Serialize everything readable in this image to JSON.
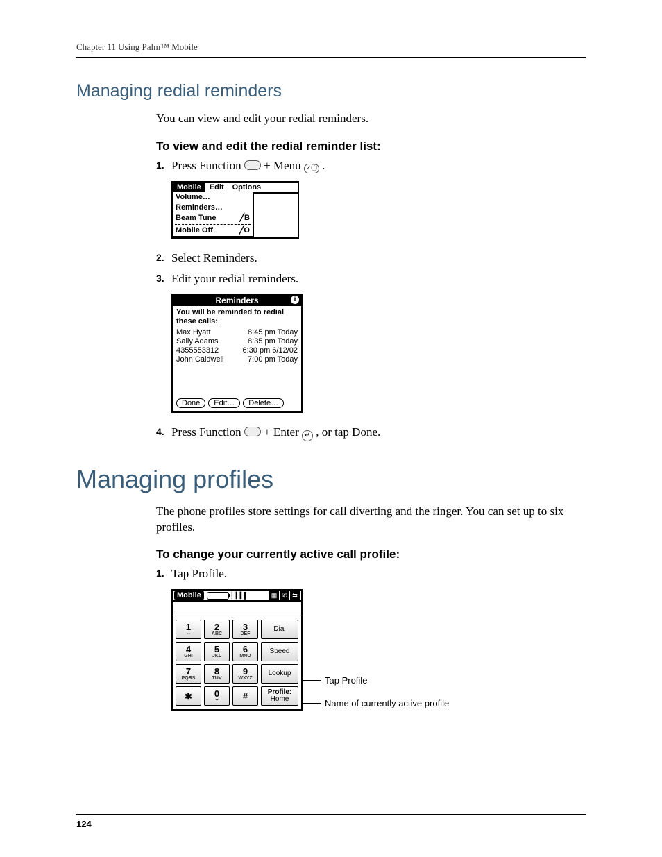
{
  "runningHead": "Chapter 11   Using Palm™ Mobile",
  "section1": {
    "title": "Managing redial reminders",
    "intro": "You can view and edit your redial reminders.",
    "procTitle": "To view and edit the redial reminder list:",
    "steps": {
      "s1a": "Press Function ",
      "s1b": " + Menu ",
      "s1c": ".",
      "s2": "Select Reminders.",
      "s3": "Edit your redial reminders.",
      "s4a": "Press Function ",
      "s4b": " + Enter ",
      "s4c": ", or tap Done."
    }
  },
  "fig1": {
    "tabs": [
      "Mobile",
      "Edit",
      "Options"
    ],
    "items": [
      {
        "label": "Volume…",
        "accel": ""
      },
      {
        "label": "Reminders…",
        "accel": ""
      },
      {
        "label": "Beam Tune",
        "accel": "╱B"
      },
      {
        "label": "Mobile Off",
        "accel": "╱O"
      }
    ]
  },
  "fig2": {
    "title": "Reminders",
    "msg": "You will be reminded to redial these calls:",
    "rows": [
      {
        "name": "Max Hyatt",
        "time": "8:45 pm Today"
      },
      {
        "name": "Sally Adams",
        "time": "8:35 pm Today"
      },
      {
        "name": "4355553312",
        "time": "6:30 pm 6/12/02"
      },
      {
        "name": "John Caldwell",
        "time": "7:00 pm Today"
      }
    ],
    "buttons": [
      "Done",
      "Edit…",
      "Delete…"
    ]
  },
  "section2": {
    "title": "Managing profiles",
    "intro": "The phone profiles store settings for call diverting and the ringer. You can set up to six profiles.",
    "procTitle": "To change your currently active call profile:",
    "step1": "Tap Profile."
  },
  "fig3": {
    "brand": "Mobile",
    "keypad": [
      {
        "d": "1",
        "s": "◦◦"
      },
      {
        "d": "2",
        "s": "ABC"
      },
      {
        "d": "3",
        "s": "DEF"
      },
      {
        "d": "4",
        "s": "GHI"
      },
      {
        "d": "5",
        "s": "JKL"
      },
      {
        "d": "6",
        "s": "MNO"
      },
      {
        "d": "7",
        "s": "PQRS"
      },
      {
        "d": "8",
        "s": "TUV"
      },
      {
        "d": "9",
        "s": "WXYZ"
      },
      {
        "d": "✱",
        "s": ""
      },
      {
        "d": "0",
        "s": "+"
      },
      {
        "d": "#",
        "s": ""
      }
    ],
    "side": [
      "Dial",
      "Speed",
      "Lookup"
    ],
    "profileLabel": "Profile:",
    "profileValue": "Home",
    "callout1": "Tap Profile",
    "callout2": "Name of currently active profile"
  },
  "pageNumber": "124",
  "keyGlyphs": {
    "menu": "✓ⓕ",
    "enter": "↵"
  }
}
